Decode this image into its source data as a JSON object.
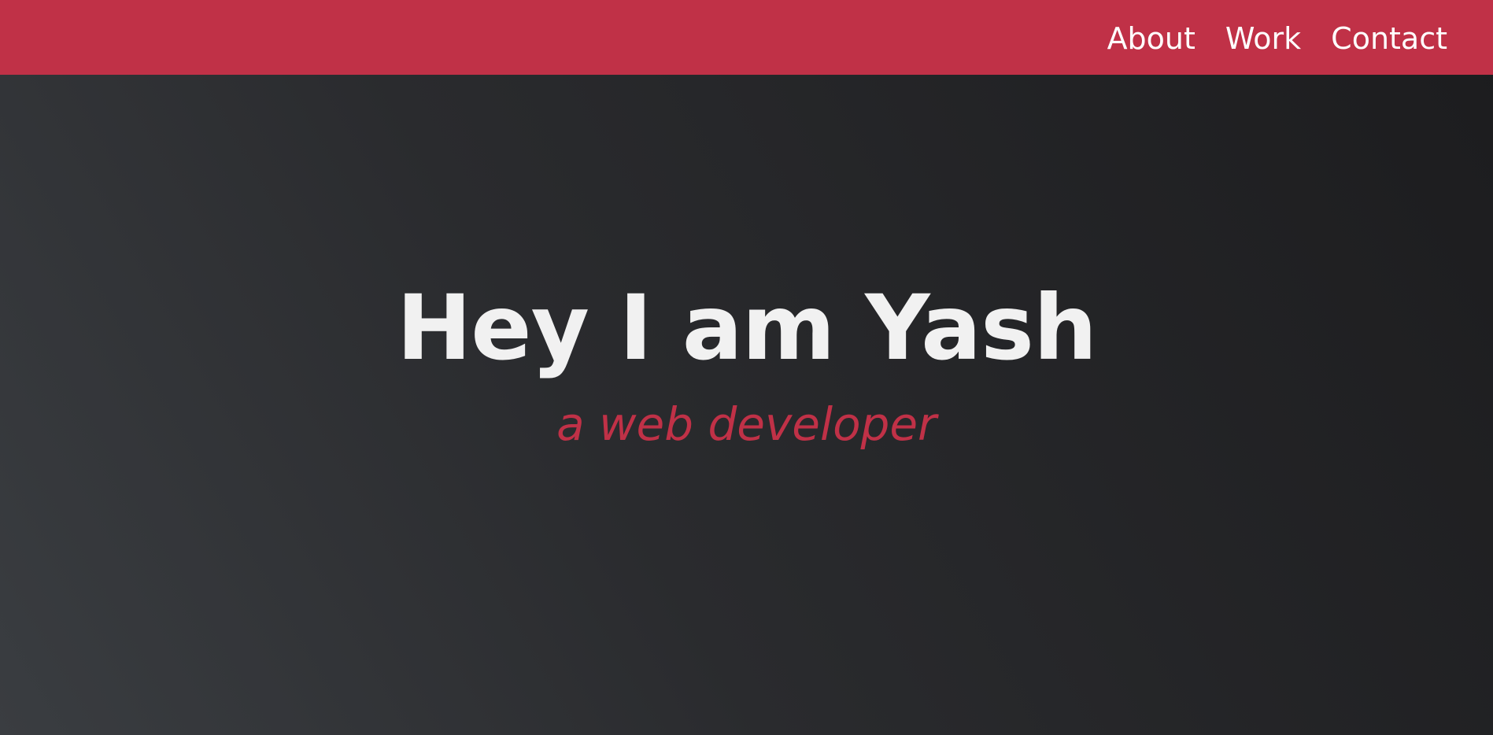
{
  "nav": {
    "items": [
      {
        "label": "About"
      },
      {
        "label": "Work"
      },
      {
        "label": "Contact"
      }
    ]
  },
  "hero": {
    "title": "Hey I am Yash",
    "subtitle": "a web developer"
  },
  "colors": {
    "accent": "#c03147",
    "background_light": "#3a3d41",
    "background_dark": "#1c1c1e",
    "title_text": "#f1f1f1"
  }
}
